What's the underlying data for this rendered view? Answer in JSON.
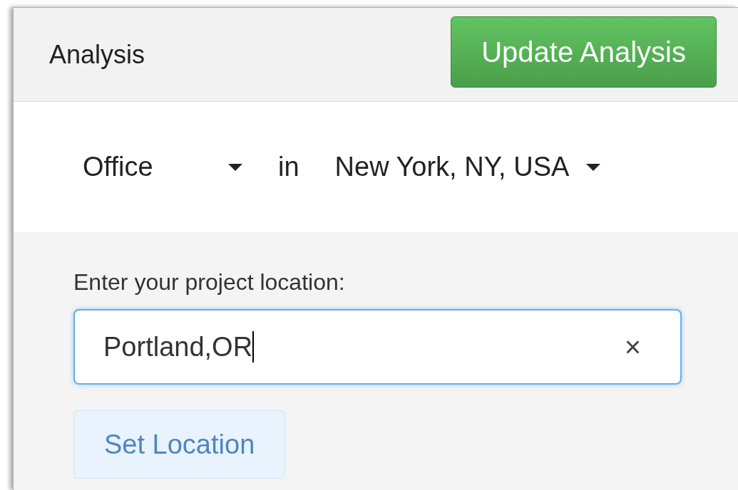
{
  "header": {
    "title": "Analysis",
    "update_button": "Update Analysis"
  },
  "filters": [
    {
      "kind": "dropdown",
      "label": "Office"
    },
    {
      "kind": "text",
      "label": "in"
    },
    {
      "kind": "dropdown",
      "label": "New York, NY, USA"
    }
  ],
  "location_form": {
    "label": "Enter your project location:",
    "value": "Portland,OR",
    "focused": true,
    "clear": "×",
    "button": "Set Location"
  }
}
